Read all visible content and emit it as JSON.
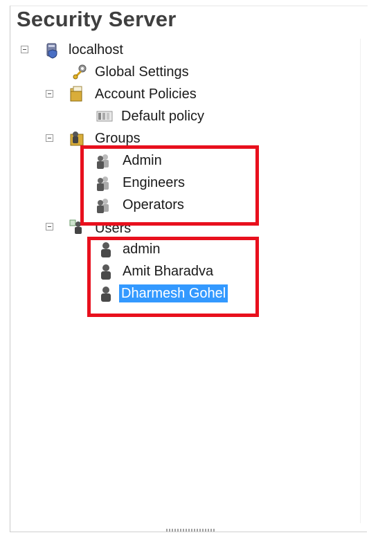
{
  "panel": {
    "title": "Security Server"
  },
  "tree": {
    "root": {
      "label": "localhost",
      "icon": "server-shield-icon",
      "expanded": true
    },
    "global_settings": {
      "label": "Global Settings",
      "icon": "gear-key-icon"
    },
    "account_policies": {
      "label": "Account Policies",
      "icon": "folder-policy-icon",
      "expanded": true
    },
    "default_policy": {
      "label": "Default policy",
      "icon": "policy-doc-icon"
    },
    "groups": {
      "label": "Groups",
      "icon": "group-folder-icon",
      "expanded": true,
      "items": [
        {
          "label": "Admin",
          "icon": "group-icon"
        },
        {
          "label": "Engineers",
          "icon": "group-icon"
        },
        {
          "label": "Operators",
          "icon": "group-icon"
        }
      ]
    },
    "users": {
      "label": "Users",
      "icon": "users-folder-icon",
      "expanded": true,
      "items": [
        {
          "label": "admin",
          "icon": "user-icon",
          "selected": false
        },
        {
          "label": "Amit Bharadva",
          "icon": "user-icon",
          "selected": false
        },
        {
          "label": "Dharmesh Gohel",
          "icon": "user-icon",
          "selected": true
        }
      ]
    }
  },
  "colors": {
    "highlight_box": "#e8101d",
    "selection": "#3399ff",
    "title_text": "#3f3f3f"
  }
}
